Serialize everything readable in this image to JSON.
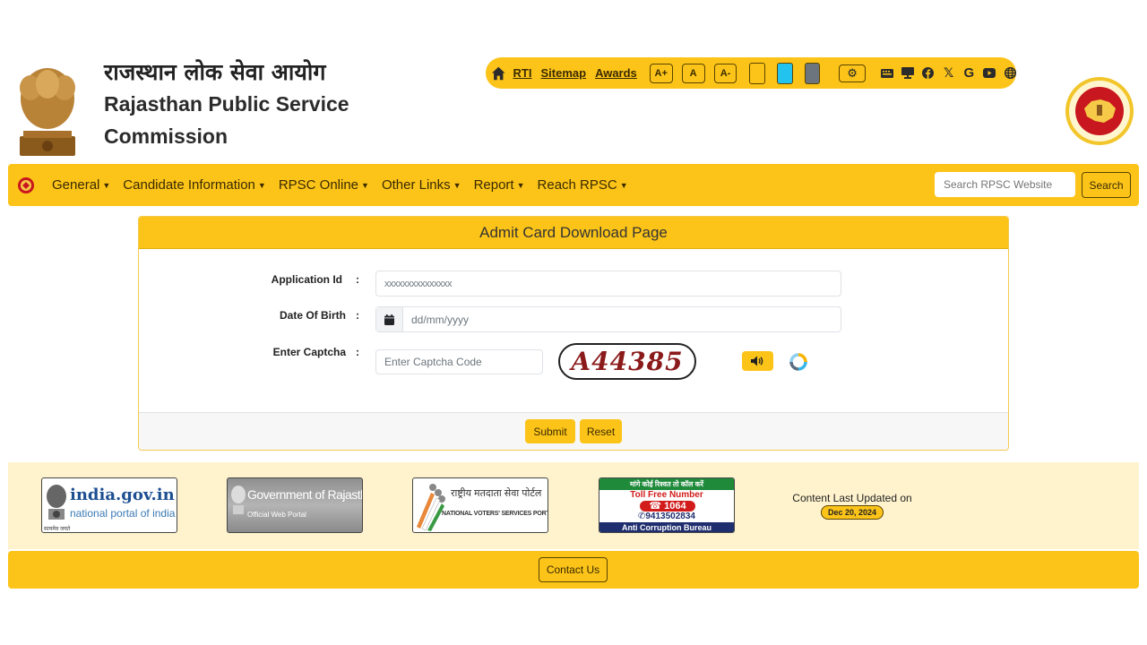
{
  "header": {
    "title_hindi": "राजस्थान लोक सेवा आयोग",
    "title_english_line1": "Rajasthan Public Service",
    "title_english_line2": "Commission"
  },
  "utility_bar": {
    "home_icon": "home-icon",
    "links": [
      "RTI",
      "Sitemap",
      "Awards"
    ],
    "font_size_buttons": [
      "A+",
      "A",
      "A-"
    ],
    "theme_swatches": [
      {
        "name": "yellow-theme",
        "color": "#fcc419"
      },
      {
        "name": "cyan-theme",
        "color": "#22c3ee"
      },
      {
        "name": "gray-theme",
        "color": "#6c757d"
      }
    ],
    "settings_icon": "gear-icon",
    "social_icons": [
      "keyboard-icon",
      "desktop-icon",
      "facebook-icon",
      "x-icon",
      "google-icon",
      "youtube-icon",
      "globe-icon"
    ]
  },
  "nav": {
    "items": [
      "General",
      "Candidate Information",
      "RPSC Online",
      "Other Links",
      "Report",
      "Reach RPSC"
    ],
    "search_placeholder": "Search RPSC Website",
    "search_button": "Search"
  },
  "form": {
    "title": "Admit Card Download Page",
    "application_id_label": "Application Id",
    "application_id_value": "xxxxxxxxxxxxxxx",
    "dob_label": "Date Of Birth",
    "dob_placeholder": "dd/mm/yyyy",
    "captcha_label": "Enter Captcha",
    "captcha_placeholder": "Enter Captcha Code",
    "captcha_text": "A44385",
    "colon": ":",
    "submit_label": "Submit",
    "reset_label": "Reset"
  },
  "footer": {
    "logos": {
      "india_gov_title": "india.gov.in",
      "india_gov_sub": "national portal of india",
      "india_gov_hindi": "सत्यमेव जयते",
      "raj_gov_title": "Government of Rajasthan",
      "raj_gov_sub": "Official Web Portal",
      "nvsp_hindi": "राष्ट्रीय मतदाता सेवा पोर्टल",
      "nvsp_english": "NATIONAL VOTERS' SERVICES PORTAL",
      "acb_hindi": "मांगे कोई रिश्वत तो कॉल करें",
      "acb_toll_free": "Toll Free Number",
      "acb_number": "1064",
      "acb_whatsapp": "9413502834",
      "acb_name": "Anti Corruption Bureau"
    },
    "content_updated_label": "Content Last Updated on",
    "content_updated_date": "Dec 20, 2024",
    "contact_us": "Contact Us"
  },
  "colors": {
    "brand_yellow": "#fcc419",
    "light_yellow": "#fff3cd"
  }
}
